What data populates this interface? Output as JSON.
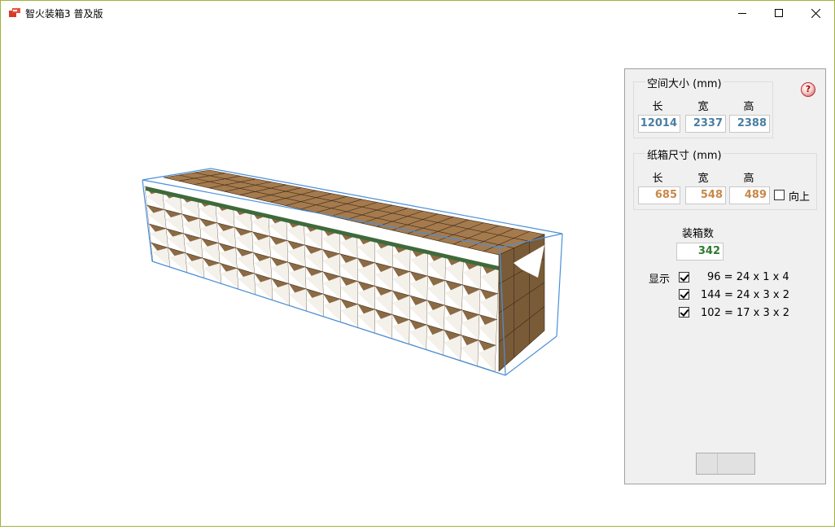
{
  "window": {
    "title": "智火装箱3 普及版",
    "controls": {
      "minimize": "minimize",
      "maximize": "maximize",
      "close": "close"
    }
  },
  "panel": {
    "space": {
      "title": "空间大小 (mm)",
      "col_length": "长",
      "col_width": "宽",
      "col_height": "高",
      "length": "12014",
      "width": "2337",
      "height": "2388"
    },
    "carton": {
      "title": "纸箱尺寸 (mm)",
      "col_length": "长",
      "col_width": "宽",
      "col_height": "高",
      "length": "685",
      "width": "548",
      "height": "489",
      "upright_label": "向上",
      "upright_checked": false
    },
    "count": {
      "label": "装箱数",
      "value": "342"
    },
    "display": {
      "label": "显示",
      "layers": [
        {
          "checked": true,
          "text": "96 = 24 x 1 x 4"
        },
        {
          "checked": true,
          "text": "144 = 24 x 3 x 2"
        },
        {
          "checked": true,
          "text": "102 = 17 x 3 x 2"
        }
      ]
    },
    "help_label": "?"
  },
  "colors": {
    "box_side": "#8b6a44",
    "box_top": "#a57a4d",
    "box_front": "#ffffff",
    "container_edge": "#4a90d9",
    "seam": "#3e6a3a"
  }
}
